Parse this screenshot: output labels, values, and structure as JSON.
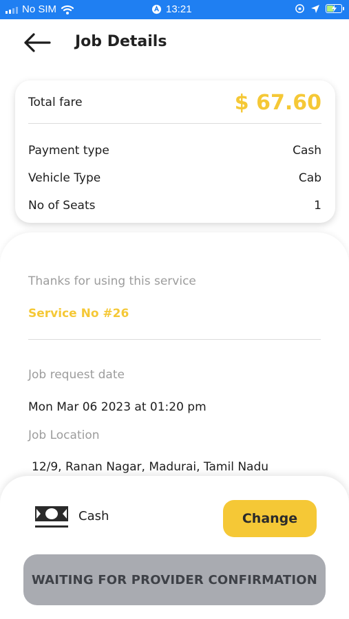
{
  "status_bar": {
    "carrier": "No SIM",
    "time": "13:21"
  },
  "header": {
    "title": "Job Details"
  },
  "fare_card": {
    "total_label": "Total fare",
    "total_value": "$ 67.60",
    "rows": [
      {
        "label": "Payment type",
        "value": "Cash"
      },
      {
        "label": "Vehicle Type",
        "value": "Cab"
      },
      {
        "label": "No of Seats",
        "value": "1"
      }
    ]
  },
  "details": {
    "thanks_text": "Thanks for using this service",
    "service_no": "Service No #26",
    "request_date_label": "Job request date",
    "request_date_value": "Mon Mar 06 2023 at 01:20 pm",
    "location_label": "Job Location",
    "location_value": "12/9, Ranan Nagar, Madurai, Tamil Nadu"
  },
  "payment_panel": {
    "method_label": "Cash",
    "change_label": "Change",
    "status_button_label": "WAITING FOR PROVIDER CONFIRMATION"
  },
  "colors": {
    "status_bar": "#1f7ff2",
    "accent": "#f5c836",
    "disabled_button": "#a9abb1"
  }
}
